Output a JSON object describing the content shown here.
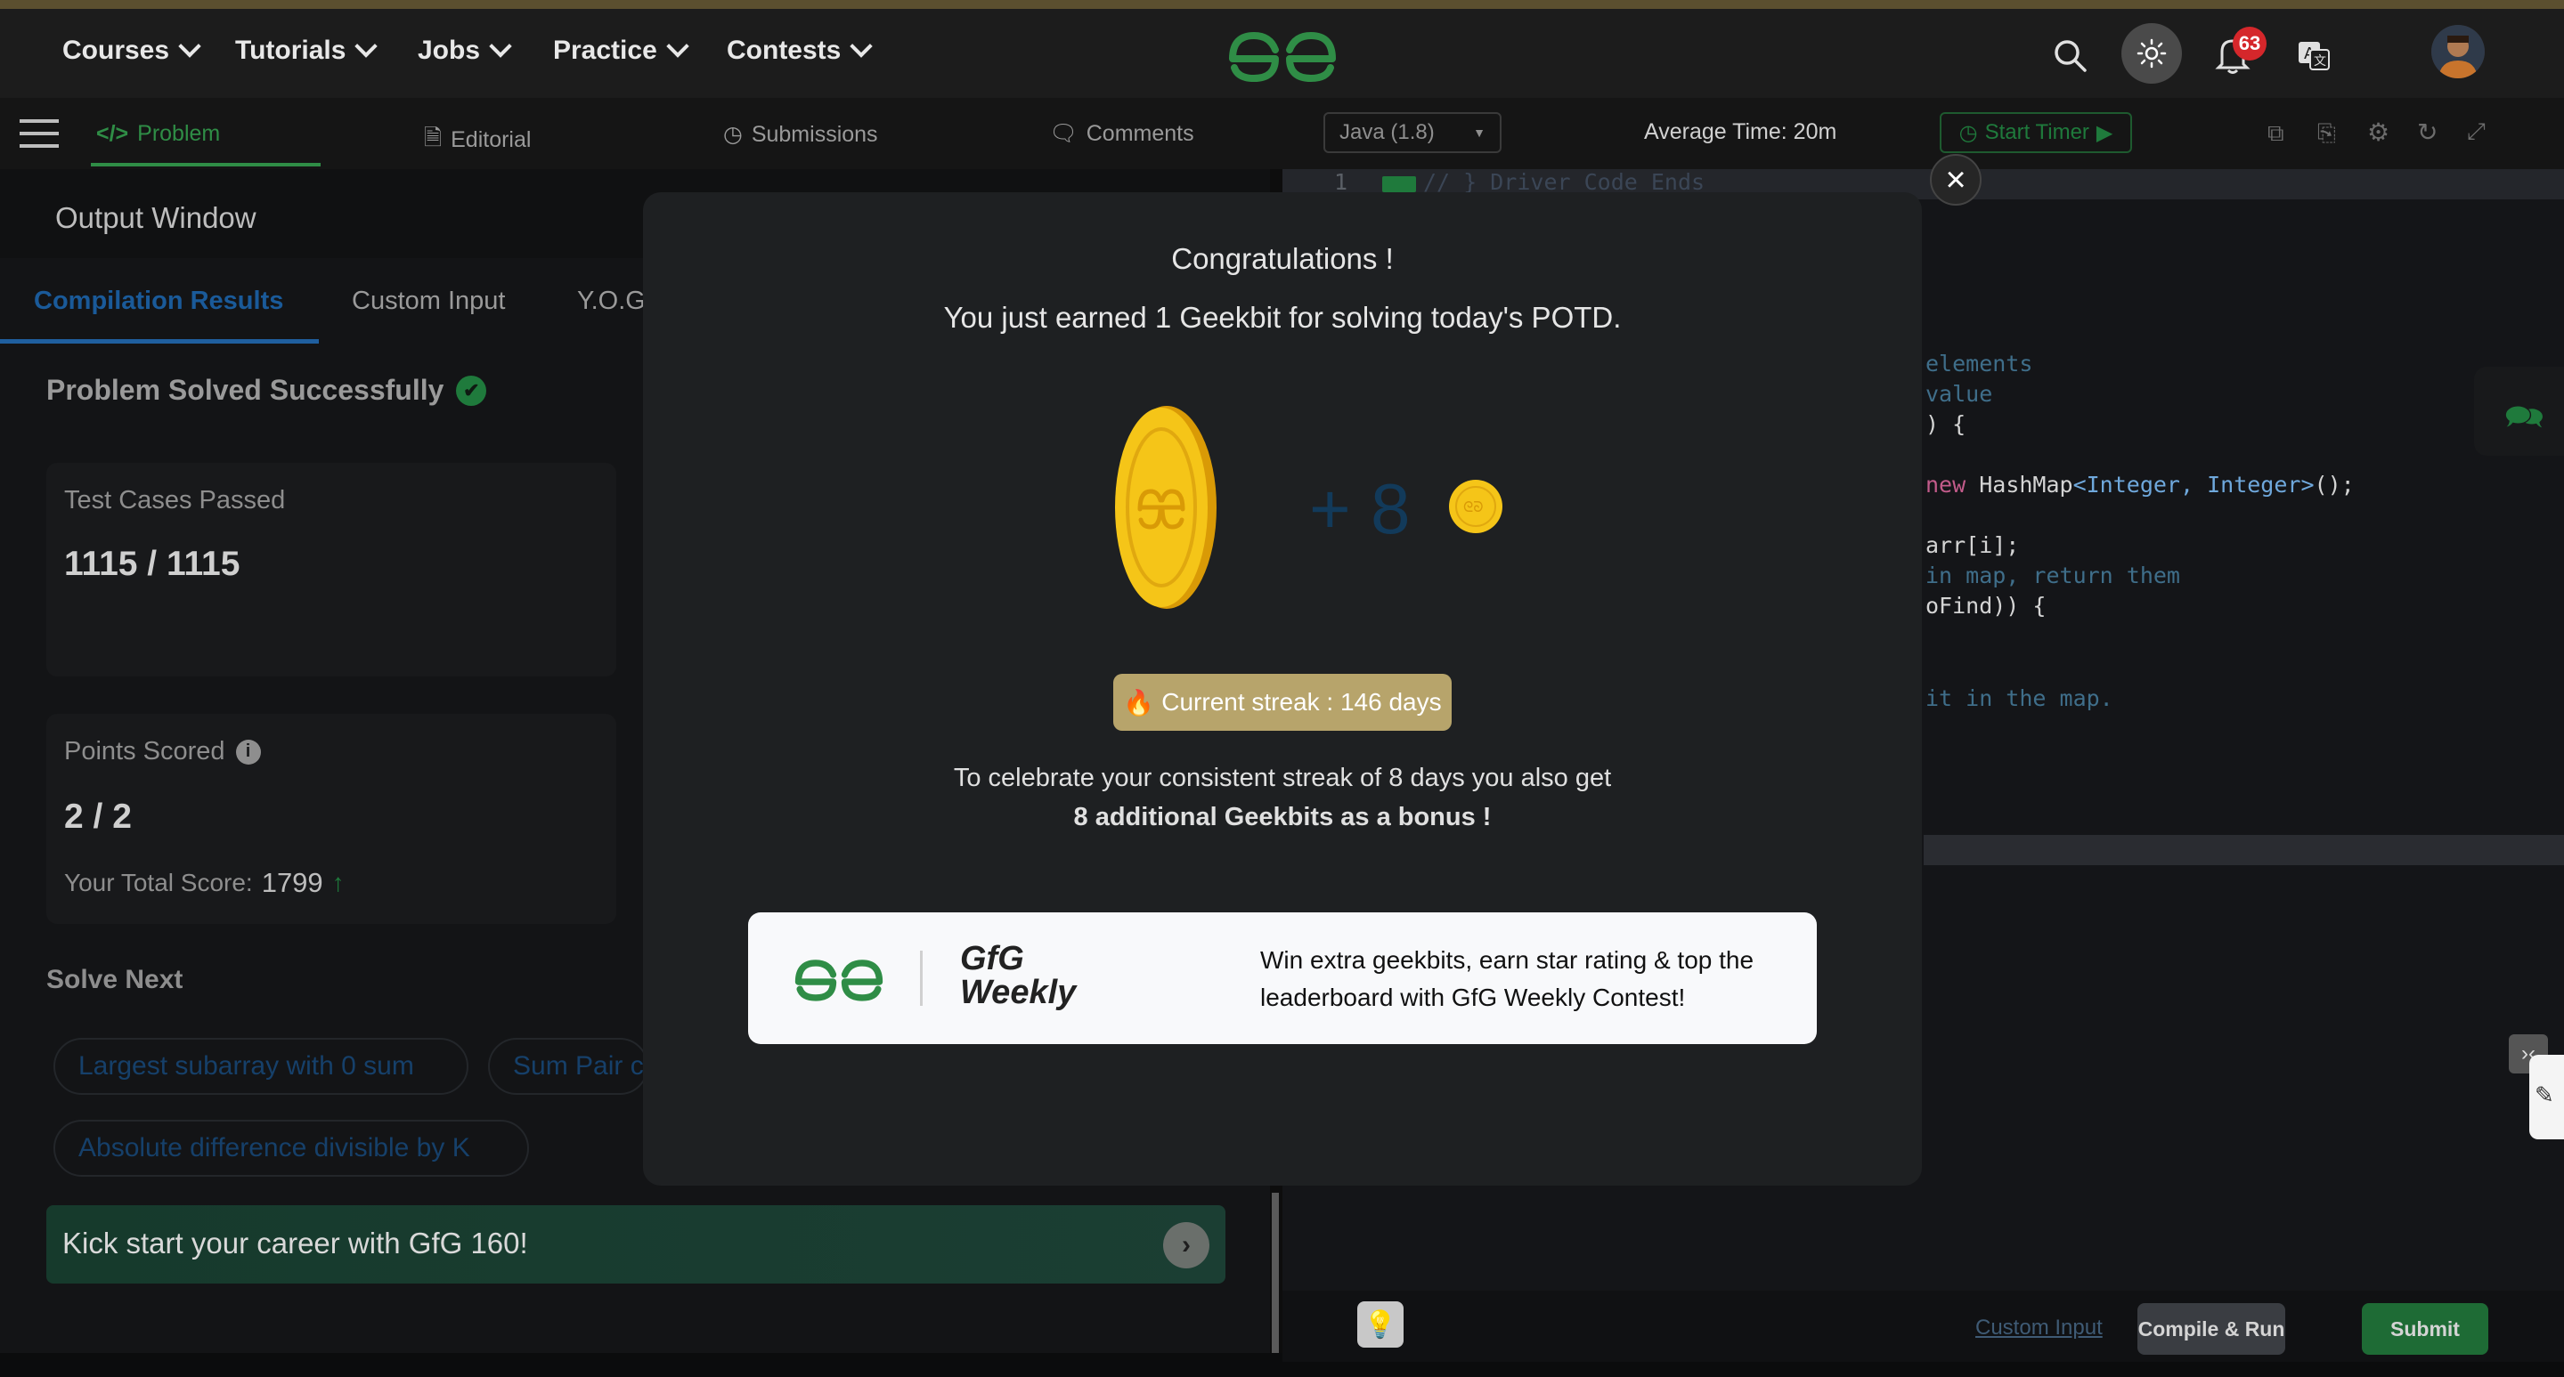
{
  "nav": {
    "items": [
      "Courses",
      "Tutorials",
      "Jobs",
      "Practice",
      "Contests"
    ],
    "notifications_count": "63"
  },
  "problem_tabs": {
    "problem": "Problem",
    "editorial": "Editorial",
    "submissions": "Submissions",
    "comments": "Comments"
  },
  "editor_header": {
    "language": "Java (1.8)",
    "average_time": "Average Time: 20m",
    "start_timer": "Start Timer"
  },
  "output": {
    "title": "Output Window",
    "tabs": [
      "Compilation Results",
      "Custom Input",
      "Y.O.G"
    ],
    "status": "Problem Solved Successfully",
    "test_cases_label": "Test Cases Passed",
    "test_cases_value": "1115 / 1115",
    "points_label": "Points Scored",
    "points_value": "2 / 2",
    "total_score_label": "Your Total Score:",
    "total_score_value": "1799",
    "solve_next_label": "Solve Next",
    "solve_next": [
      "Largest subarray with 0 sum",
      "Sum Pair c",
      "Absolute difference divisible by K"
    ],
    "banner_text": "Kick start your career with GfG 160!"
  },
  "code_lines": {
    "line1_num": "1",
    "line1": "// } Driver Code Ends",
    "l2": "elements",
    "l3": "value",
    "l4": ") {",
    "l5_kw": "new",
    "l5_a": "HashMap",
    "l5_b": "<Integer, Integer>",
    "l5_c": "();",
    "l6": "arr[i];",
    "l7": "in map, return them",
    "l8": "oFind)) {",
    "l9": "it in the map."
  },
  "footer": {
    "custom_input": "Custom Input",
    "compile_run": "Compile & Run",
    "submit": "Submit"
  },
  "modal": {
    "congrats": "Congratulations !",
    "earned": "You just earned 1 Geekbit for solving today's POTD.",
    "plus_bonus": "+ 8",
    "streak": "Current streak : 146 days",
    "bonus_line1": "To celebrate your consistent streak of 8 days you also get",
    "bonus_line2": "8 additional Geekbits as a bonus !",
    "weekly_brand_top": "GfG",
    "weekly_brand_bottom": "Weekly",
    "weekly_text": "Win extra geekbits, earn star rating & top the leaderboard with GfG Weekly Contest!"
  },
  "colors": {
    "brand_green": "#2f8d46",
    "link_blue": "#1a5a99",
    "coin_gold": "#f5c518",
    "streak_bg": "#b7a46b",
    "submit_green": "#1e6b35"
  }
}
